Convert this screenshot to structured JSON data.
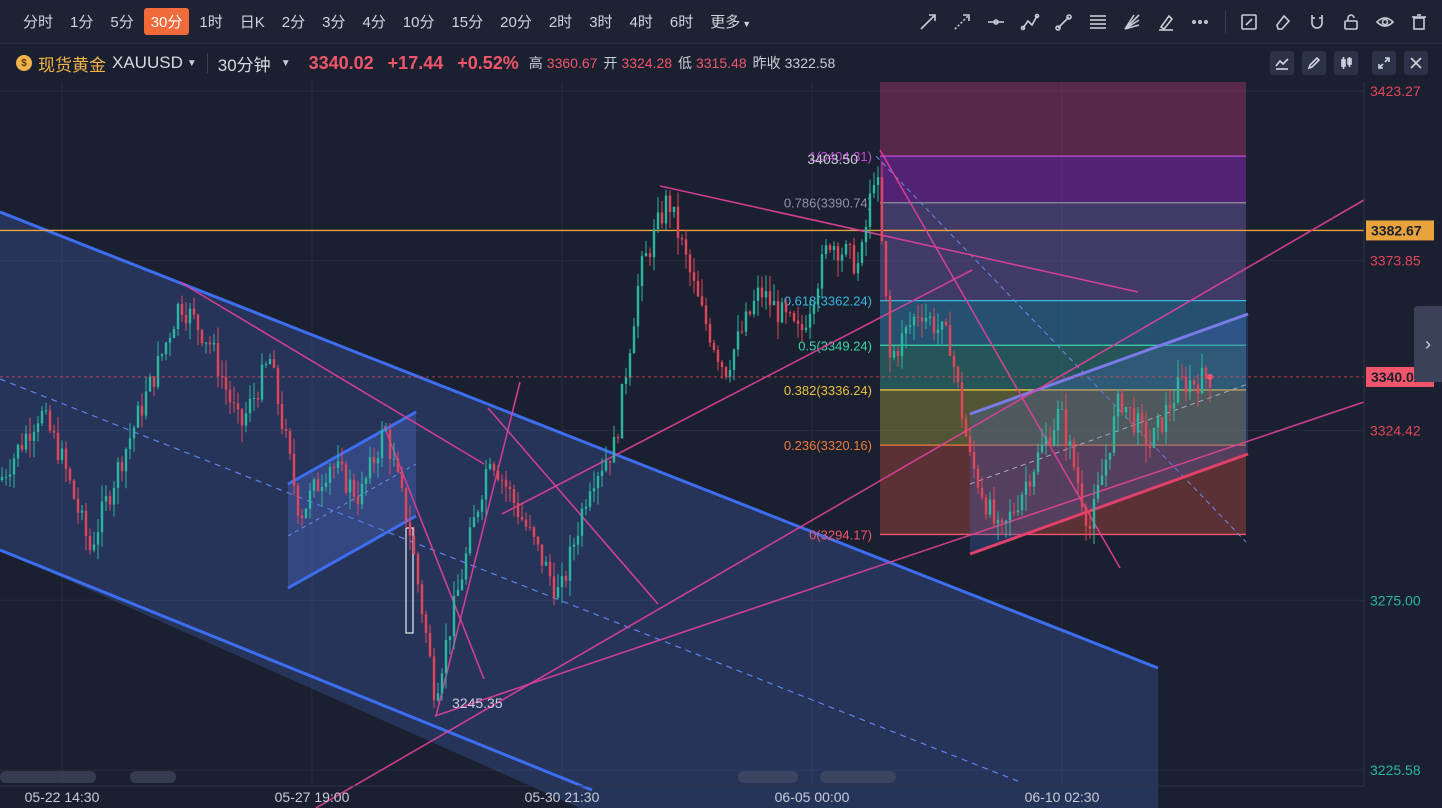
{
  "toolbar": {
    "intervals": [
      "分时",
      "1分",
      "5分",
      "30分",
      "1时",
      "日K",
      "2分",
      "3分",
      "4分",
      "10分",
      "15分",
      "20分",
      "2时",
      "3时",
      "4时",
      "6时",
      "更多"
    ],
    "active_interval": "30分",
    "tool_icons": [
      "trend-line-icon",
      "ray-icon",
      "horizontal-line-icon",
      "polyline-icon",
      "brush-icon",
      "fibonacci-icon",
      "gann-fan-icon",
      "highlighter-icon",
      "more-tools-icon",
      "note-icon",
      "eraser-icon",
      "magnet-icon",
      "lock-icon",
      "visibility-icon",
      "trash-icon"
    ]
  },
  "info": {
    "symbol_name": "现货黄金",
    "symbol_code": "XAUUSD",
    "period": "30分钟",
    "last": "3340.02",
    "change": "+17.44",
    "change_pct": "+0.52%",
    "high_label": "高",
    "high": "3360.67",
    "open_label": "开",
    "open": "3324.28",
    "low_label": "低",
    "low": "3315.48",
    "prev_label": "昨收",
    "prev_close": "3322.58"
  },
  "chart_data": {
    "type": "candlestick",
    "symbol": "XAUUSD",
    "interval": "30分钟",
    "ylim": [
      3220,
      3430
    ],
    "price_axis_ticks": [
      "3423.27",
      "3373.85",
      "3324.42",
      "3275.00",
      "3225.58"
    ],
    "price_axis_markers": [
      {
        "label": "3382.67",
        "value": 3382.67,
        "color": "#e8a33c"
      },
      {
        "label": "3340.02",
        "value": 3340.02,
        "color": "#f0556a"
      }
    ],
    "time_axis_ticks": [
      "05-22 14:30",
      "05-27 19:00",
      "05-30 21:30",
      "06-05 00:00",
      "06-10 02:30"
    ],
    "annotations": [
      {
        "label": "3403.50",
        "value": 3403.5
      },
      {
        "label": "3245.35",
        "value": 3245.35
      }
    ],
    "fibonacci": [
      {
        "label": "1(3404.31)",
        "value": 3404.31,
        "color": "#c44bd6"
      },
      {
        "label": "0.786(3390.74)",
        "value": 3390.74,
        "color": "#8f93a6"
      },
      {
        "label": "0.618(3362.24)",
        "value": 3362.24,
        "color": "#3ab6e0"
      },
      {
        "label": "0.5(3349.24)",
        "value": 3349.24,
        "color": "#3ad6a8"
      },
      {
        "label": "0.382(3336.24)",
        "value": 3336.24,
        "color": "#e8c23a"
      },
      {
        "label": "0.236(3320.16)",
        "value": 3320.16,
        "color": "#f07a3a"
      },
      {
        "label": "0(3294.17)",
        "value": 3294.17,
        "color": "#f0556a"
      }
    ]
  }
}
